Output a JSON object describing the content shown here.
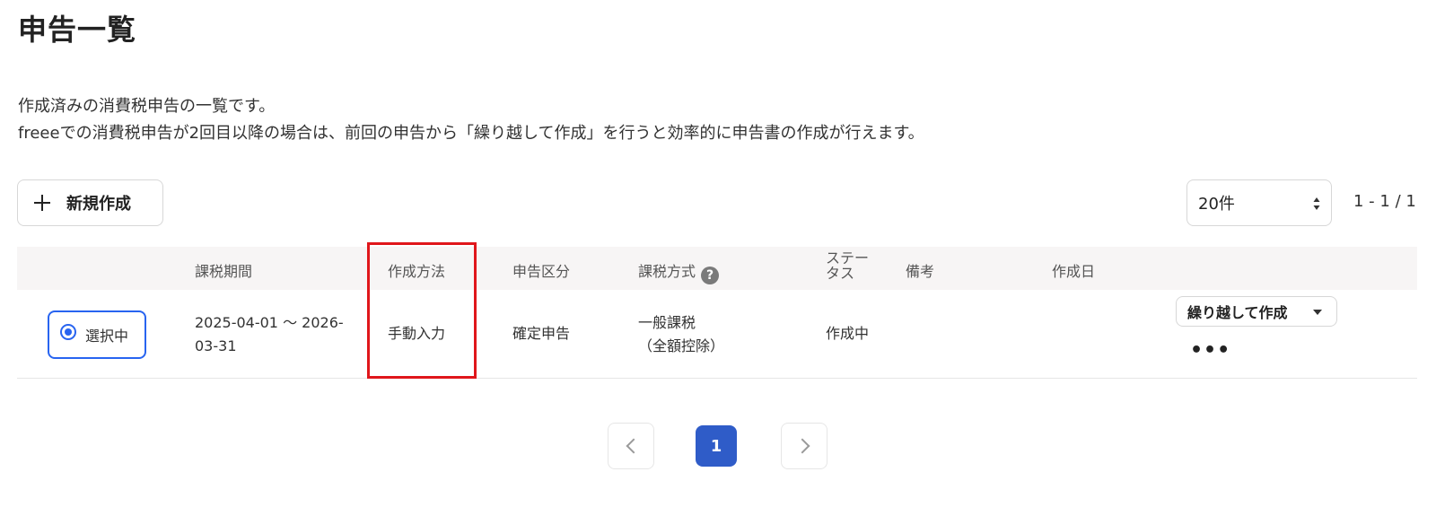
{
  "header": {
    "title": "申告一覧"
  },
  "description": {
    "line1": "作成済みの消費税申告の一覧です。",
    "line2": "freeeでの消費税申告が2回目以降の場合は、前回の申告から「繰り越して作成」を行うと効率的に申告書の作成が行えます。"
  },
  "toolbar": {
    "new_label": "新規作成",
    "per_page": "20件",
    "range": "1 - 1 / 1"
  },
  "table": {
    "columns": {
      "period": "課税期間",
      "method": "作成方法",
      "kind": "申告区分",
      "tax_method": "課税方式",
      "status": "ステータス",
      "notes": "備考",
      "created": "作成日"
    },
    "rows": [
      {
        "selected_label": "選択中",
        "period": "2025-04-01 〜 2026-03-31",
        "method": "手動入力",
        "kind": "確定申告",
        "tax_method_line1": "一般課税",
        "tax_method_line2": "（全額控除）",
        "status": "作成中",
        "notes": "",
        "created": "",
        "carry_label": "繰り越して作成"
      }
    ]
  },
  "pagination": {
    "current": "1"
  },
  "colors": {
    "accent": "#2864f0",
    "pager_active": "#2f5cc8",
    "highlight": "#e0161b"
  },
  "icons": {
    "new": "plus-icon",
    "help": "question-circle-icon",
    "more": "ellipsis-icon",
    "prev": "chevron-left-icon",
    "next": "chevron-right-icon"
  }
}
